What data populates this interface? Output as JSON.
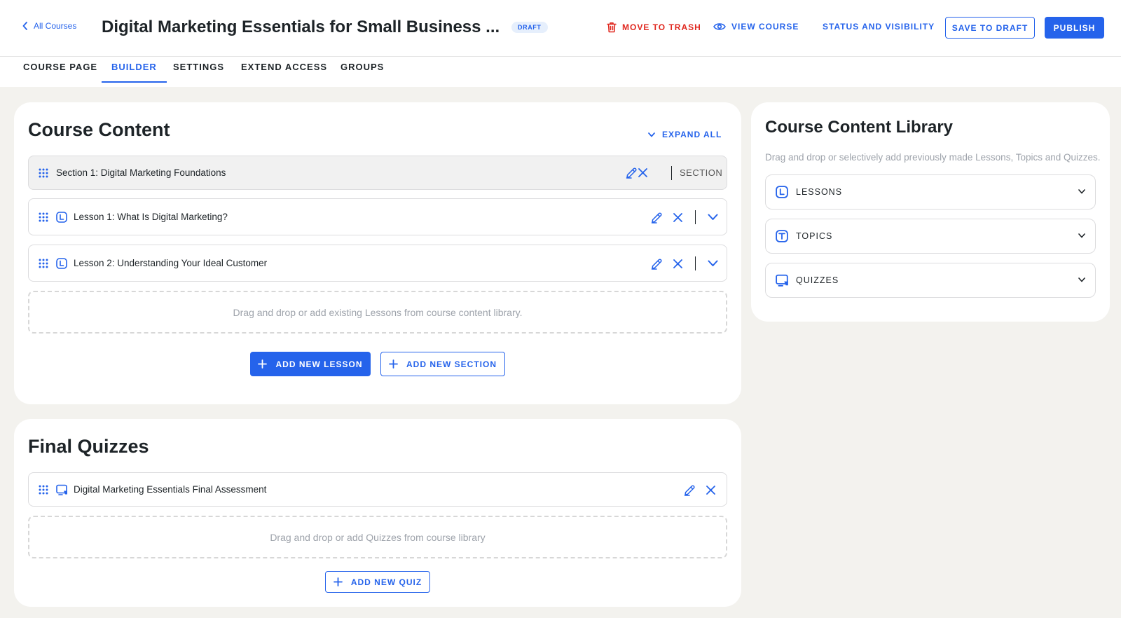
{
  "header": {
    "back_label": "All Courses",
    "course_title": "Digital Marketing Essentials for Small Business ...",
    "status_badge": "DRAFT",
    "move_to_trash": "MOVE TO TRASH",
    "view_course": "VIEW COURSE",
    "status_visibility": "STATUS AND VISIBILITY",
    "save_to_draft": "SAVE TO DRAFT",
    "publish": "PUBLISH"
  },
  "tabs": [
    {
      "label": "COURSE PAGE"
    },
    {
      "label": "BUILDER",
      "active": true
    },
    {
      "label": "SETTINGS"
    },
    {
      "label": "EXTEND ACCESS"
    },
    {
      "label": "GROUPS"
    }
  ],
  "course_content": {
    "title": "Course Content",
    "expand_all": "EXPAND ALL",
    "section": {
      "label": "Section 1: Digital Marketing Foundations",
      "tag": "SECTION"
    },
    "lessons": [
      {
        "label": "Lesson 1: What Is Digital Marketing?",
        "icon": "lesson-icon"
      },
      {
        "label": "Lesson 2: Understanding Your Ideal Customer",
        "icon": "lesson-icon"
      }
    ],
    "dropzone": "Drag and drop or add existing Lessons from course content library.",
    "add_lesson": "ADD NEW LESSON",
    "add_section": "ADD NEW SECTION"
  },
  "final_quizzes": {
    "title": "Final Quizzes",
    "quizzes": [
      {
        "label": "Digital Marketing Essentials Final Assessment",
        "icon": "quiz-icon"
      }
    ],
    "dropzone": "Drag and drop or add Quizzes from course library",
    "add_quiz": "ADD NEW QUIZ"
  },
  "library": {
    "title": "Course Content Library",
    "subtitle": "Drag and drop or selectively add previously made Lessons, Topics and Quizzes.",
    "items": [
      {
        "label": "LESSONS",
        "icon": "lesson-icon"
      },
      {
        "label": "TOPICS",
        "icon": "topic-icon"
      },
      {
        "label": "QUIZZES",
        "icon": "quiz-icon"
      }
    ]
  },
  "colors": {
    "accent": "#2563eb",
    "danger": "#e0281f",
    "background": "#f3f2ee",
    "text": "#1d2327"
  }
}
